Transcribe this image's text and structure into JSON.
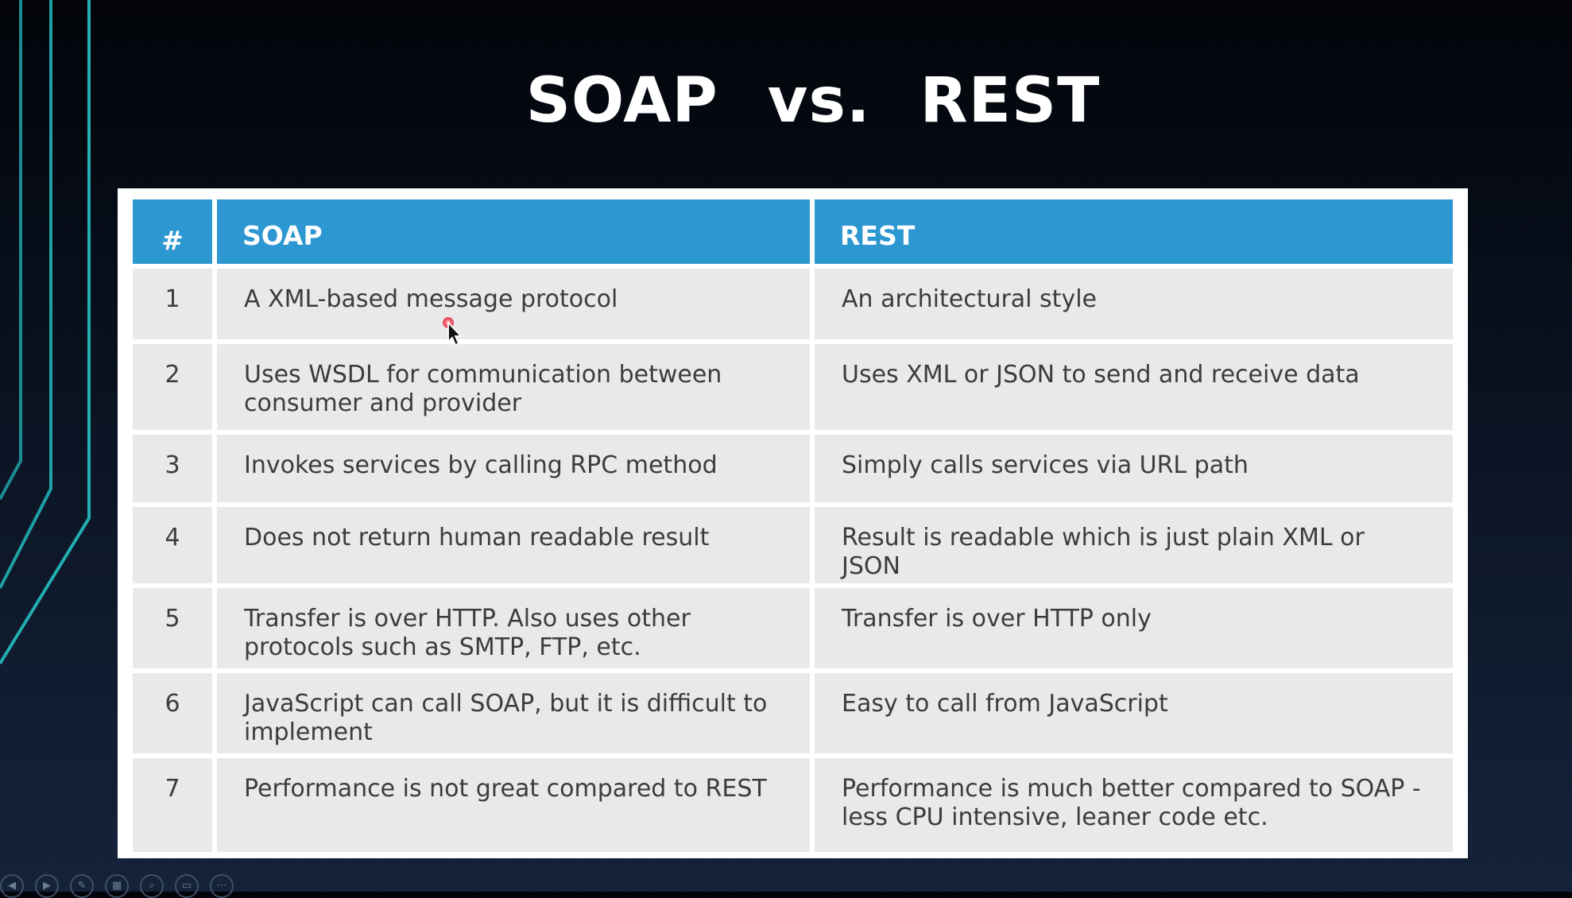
{
  "slide": {
    "title_left": "SOAP",
    "title_mid": "vs.",
    "title_right": "REST"
  },
  "table": {
    "headers": [
      "#",
      "SOAP",
      "REST"
    ],
    "rows": [
      {
        "num": "1",
        "soap": "A XML-based message protocol",
        "rest": "An architectural style"
      },
      {
        "num": "2",
        "soap": "Uses WSDL for communication between consumer and provider",
        "rest": "Uses XML or JSON to send and receive data"
      },
      {
        "num": "3",
        "soap": "Invokes services by calling RPC method",
        "rest": "Simply calls services via URL path"
      },
      {
        "num": "4",
        "soap": "Does not return human readable result",
        "rest": "Result is readable which is just plain XML or JSON"
      },
      {
        "num": "5",
        "soap": "Transfer is over HTTP. Also uses other protocols such as SMTP, FTP, etc.",
        "rest": "Transfer is over HTTP only"
      },
      {
        "num": "6",
        "soap": "JavaScript can call SOAP, but it is difficult to implement",
        "rest": "Easy to call from JavaScript"
      },
      {
        "num": "7",
        "soap": "Performance is not great compared to REST",
        "rest": "Performance is much better compared to SOAP - less CPU intensive, leaner code etc."
      }
    ]
  },
  "toolbar": {
    "buttons": [
      {
        "name": "previous-slide-icon",
        "glyph": "◀"
      },
      {
        "name": "next-slide-icon",
        "glyph": "▶"
      },
      {
        "name": "pen-icon",
        "glyph": "✎"
      },
      {
        "name": "slides-grid-icon",
        "glyph": "▦"
      },
      {
        "name": "zoom-icon",
        "glyph": "⌕"
      },
      {
        "name": "subtitles-icon",
        "glyph": "▭"
      },
      {
        "name": "more-options-icon",
        "glyph": "⋯"
      }
    ]
  },
  "colors": {
    "header_blue": "#2d97d1",
    "row_gray": "#e9e9ec",
    "accent_teal": "#1fa0a4",
    "laser_pointer": "#e8384f"
  }
}
